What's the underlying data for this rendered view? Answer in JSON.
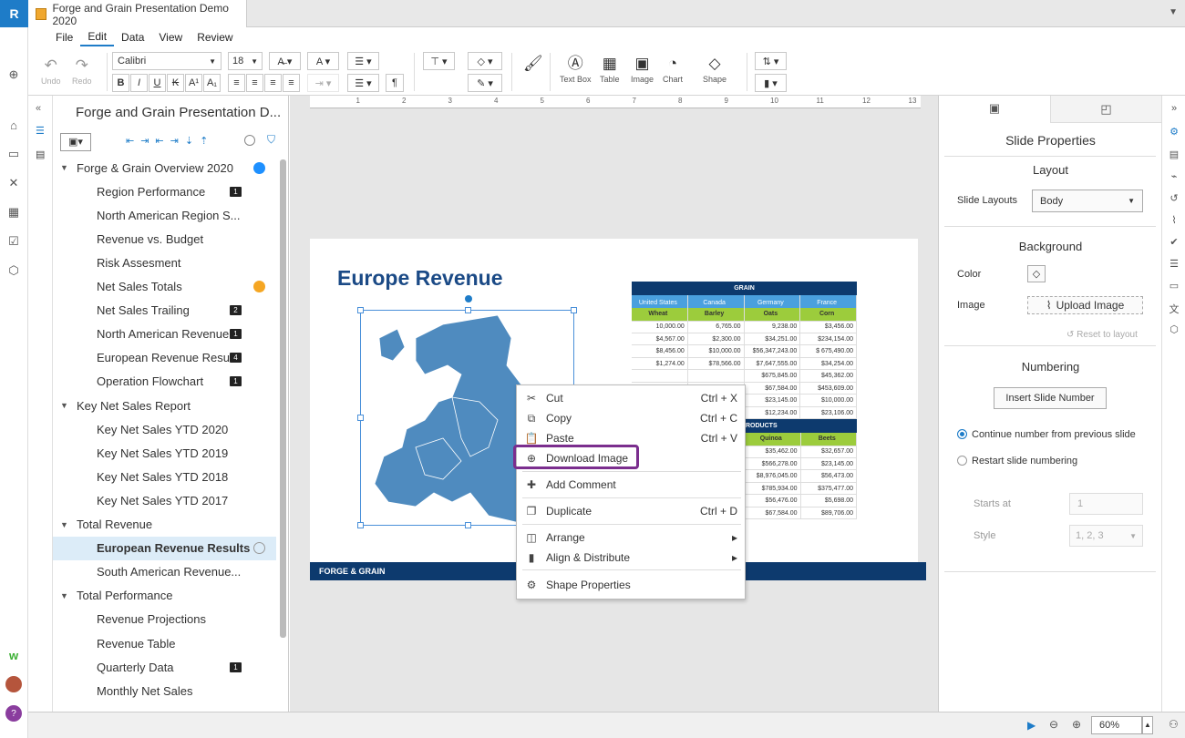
{
  "app": {
    "logo": "R"
  },
  "tab": {
    "title": "Forge and Grain Presentation Demo 2020"
  },
  "menu": [
    "File",
    "Edit",
    "Data",
    "View",
    "Review"
  ],
  "toolbar": {
    "undo": "Undo",
    "redo": "Redo",
    "font": "Calibri",
    "size": "18",
    "textbox": "Text Box",
    "table": "Table",
    "image": "Image",
    "chart": "Chart",
    "shape": "Shape"
  },
  "outline": {
    "title": "Forge and Grain Presentation D...",
    "rows": [
      {
        "label": "Forge & Grain Overview 2020",
        "kind": "section",
        "dot": "#1e90ff"
      },
      {
        "label": "Region Performance",
        "kind": "item",
        "badge": "1"
      },
      {
        "label": "North American Region S...",
        "kind": "item"
      },
      {
        "label": "Revenue vs. Budget",
        "kind": "item"
      },
      {
        "label": "Risk Assesment",
        "kind": "item"
      },
      {
        "label": "Net Sales Totals",
        "kind": "item",
        "dot": "#f5a623"
      },
      {
        "label": "Net Sales Trailing",
        "kind": "item",
        "badge": "2"
      },
      {
        "label": "North American Revenue...",
        "kind": "item",
        "badge": "1"
      },
      {
        "label": "European Revenue Results",
        "kind": "item",
        "badge": "4"
      },
      {
        "label": "Operation Flowchart",
        "kind": "item",
        "badge": "1"
      },
      {
        "label": "Key Net Sales Report",
        "kind": "section"
      },
      {
        "label": "Key Net Sales YTD 2020",
        "kind": "item"
      },
      {
        "label": "Key Net Sales YTD 2019",
        "kind": "item"
      },
      {
        "label": "Key Net Sales YTD 2018",
        "kind": "item"
      },
      {
        "label": "Key Net Sales YTD 2017",
        "kind": "item"
      },
      {
        "label": "Total Revenue",
        "kind": "section"
      },
      {
        "label": "European Revenue Results",
        "kind": "item",
        "selected": true
      },
      {
        "label": "South American Revenue...",
        "kind": "item"
      },
      {
        "label": "Total Performance",
        "kind": "section"
      },
      {
        "label": "Revenue Projections",
        "kind": "item"
      },
      {
        "label": "Revenue Table",
        "kind": "item"
      },
      {
        "label": "Quarterly Data",
        "kind": "item",
        "badge": "1"
      },
      {
        "label": "Monthly Net Sales",
        "kind": "item"
      }
    ]
  },
  "slide": {
    "title": "Europe Revenue",
    "footer": "FORGE & GRAIN",
    "table": {
      "header": "GRAIN",
      "countries": [
        "United States",
        "Canada",
        "Germany",
        "France"
      ],
      "crops": [
        "Wheat",
        "Barley",
        "Oats",
        "Corn"
      ],
      "rows": [
        [
          "10,000.00",
          "6,765.00",
          "9,238.00",
          "$3,456.00"
        ],
        [
          "$4,567.00",
          "$2,300.00",
          "$34,251.00",
          "$234,154.00"
        ],
        [
          "$8,456.00",
          "$10,000.00",
          "$56,347,243.00",
          "$ 675,490.00"
        ],
        [
          "$1,274.00",
          "$78,566.00",
          "$7,647,555.00",
          "$34,254.00"
        ],
        [
          "",
          "",
          "$675,845.00",
          "$45,362.00"
        ],
        [
          "",
          "",
          "$67,584.00",
          "$453,609.00"
        ],
        [
          "",
          "",
          "$23,145.00",
          "$10,000.00"
        ],
        [
          "",
          "",
          "$12,234.00",
          "$23,106.00"
        ]
      ],
      "header2": "RODUCTS",
      "crops2": [
        "Quinoa",
        "Beets"
      ],
      "rows2": [
        [
          "$35,462.00",
          "$32,657.00"
        ],
        [
          "$566,278.00",
          "$23,145.00"
        ],
        [
          "$8,976,045.00",
          "$56,473.00"
        ],
        [
          "$785,934.00",
          "$375,477.00"
        ],
        [
          "$56,476.00",
          "$5,698.00"
        ],
        [
          "$67,584.00",
          "$89,706.00"
        ]
      ]
    }
  },
  "context_menu": [
    {
      "label": "Cut",
      "shortcut": "Ctrl + X",
      "icon": "✂"
    },
    {
      "label": "Copy",
      "shortcut": "Ctrl + C",
      "icon": "⧉"
    },
    {
      "label": "Paste",
      "shortcut": "Ctrl + V",
      "icon": "📋"
    },
    {
      "label": "Download Image",
      "shortcut": "",
      "icon": "⊕"
    },
    {
      "label": "Add Comment",
      "shortcut": "",
      "icon": "✚"
    },
    {
      "label": "Duplicate",
      "shortcut": "Ctrl + D",
      "icon": "❐"
    },
    {
      "label": "Arrange",
      "shortcut": "▸",
      "icon": "◫"
    },
    {
      "label": "Align & Distribute",
      "shortcut": "▸",
      "icon": "▮"
    },
    {
      "label": "Shape Properties",
      "shortcut": "",
      "icon": "⚙"
    }
  ],
  "properties": {
    "title": "Slide Properties",
    "layout_head": "Layout",
    "slide_layouts_label": "Slide Layouts",
    "slide_layouts_value": "Body",
    "background_head": "Background",
    "color_label": "Color",
    "image_label": "Image",
    "upload_label": "Upload Image",
    "reset_label": "Reset to layout",
    "numbering_head": "Numbering",
    "insert_number": "Insert Slide Number",
    "continue_label": "Continue number from previous slide",
    "restart_label": "Restart slide numbering",
    "starts_at_label": "Starts at",
    "starts_at_value": "1",
    "style_label": "Style",
    "style_value": "1, 2, 3"
  },
  "status": {
    "zoom": "60%"
  }
}
